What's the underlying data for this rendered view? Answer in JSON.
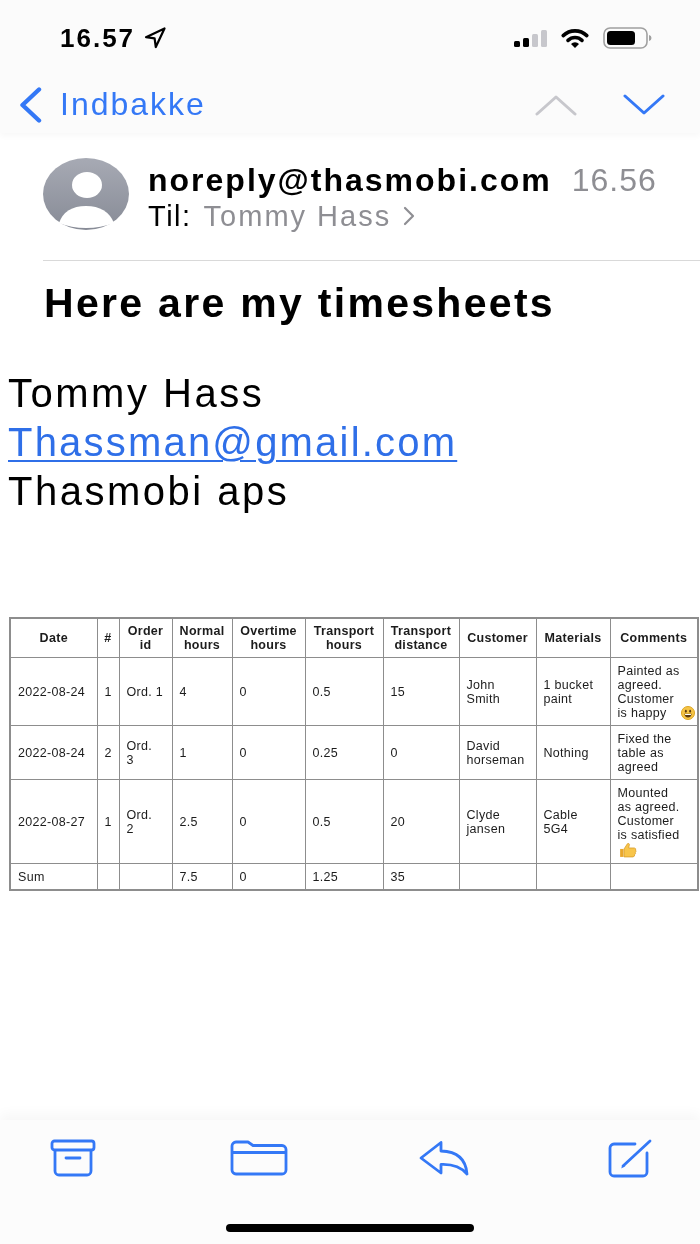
{
  "status_bar": {
    "time": "16.57"
  },
  "nav": {
    "back_label": "Indbakke",
    "buttons": [
      {
        "kind": "previous",
        "disabled": true
      },
      {
        "kind": "next",
        "disabled": false
      }
    ]
  },
  "message": {
    "sender": "noreply@thasmobi.com",
    "time": "16.56",
    "to_label": "Til:",
    "recipient": "Tommy Hass",
    "subject": "Here are my timesheets"
  },
  "body": [
    {
      "kind": "text",
      "text": "Tommy Hass"
    },
    {
      "kind": "link",
      "text": "Thassman@gmail.com"
    },
    {
      "kind": "text",
      "text": "Thasmobi aps"
    }
  ],
  "table": {
    "columns": [
      "Date",
      "#",
      "Order\nid",
      "Normal\nhours",
      "Overtime\nhours",
      "Transport\nhours",
      "Transport\ndistance",
      "Customer",
      "Materials",
      "Comments"
    ],
    "rows": [
      {
        "date": "2022-08-24",
        "number": "1",
        "order_id": "Ord. 1",
        "normal_hours": "4",
        "overtime_hours": "0",
        "transport_hours": "0.5",
        "transport_distance": "15",
        "customer": "John\nSmith",
        "materials": "1 bucket\npaint",
        "comments": "Painted as\nagreed.\nCustomer\nis happy",
        "comment_icon": {
          "kind": "smiley"
        }
      },
      {
        "date": "2022-08-24",
        "number": "2",
        "order_id": "Ord.\n3",
        "normal_hours": "1",
        "overtime_hours": "0",
        "transport_hours": "0.25",
        "transport_distance": "0",
        "customer": "David\nhorseman",
        "materials": "Nothing",
        "comments": "Fixed the\ntable as\nagreed"
      },
      {
        "date": "2022-08-27",
        "number": "1",
        "order_id": "Ord.\n2",
        "normal_hours": "2.5",
        "overtime_hours": "0",
        "transport_hours": "0.5",
        "transport_distance": "20",
        "customer": "Clyde\njansen",
        "materials": "Cable\n5G4",
        "comments": "Mounted\nas agreed.\nCustomer\nis satisfied",
        "comment_icon": {
          "kind": "thumbs-up"
        }
      }
    ],
    "sum_row": {
      "label": "Sum",
      "normal_hours": "7.5",
      "overtime_hours": "0",
      "transport_hours": "1.25",
      "transport_distance": "35"
    }
  }
}
